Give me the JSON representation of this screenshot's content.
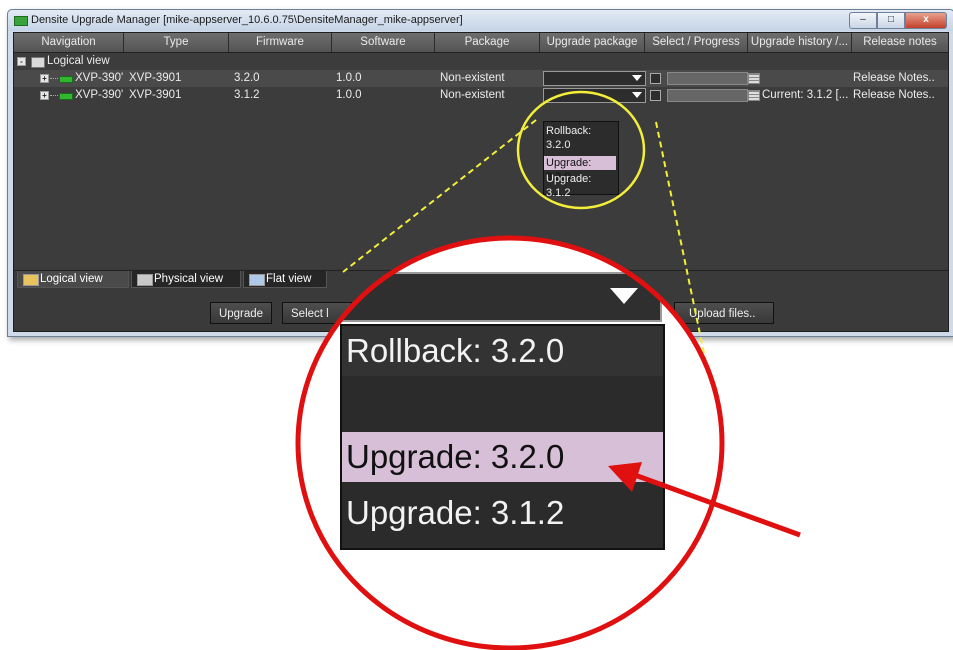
{
  "window": {
    "title": "Densite Upgrade Manager [mike-appserver_10.6.0.75\\DensiteManager_mike-appserver]",
    "min_glyph": "–",
    "max_glyph": "□",
    "close_glyph": "x"
  },
  "table": {
    "headers": [
      "Navigation",
      "Type",
      "Firmware",
      "Software",
      "Package",
      "Upgrade package",
      "Select / Progress",
      "Upgrade history /...",
      "Release notes"
    ],
    "root_label": "Logical view",
    "rows": [
      {
        "name": "XVP-390'",
        "type": "XVP-3901",
        "firmware": "3.2.0",
        "software": "1.0.0",
        "package": "Non-existent",
        "history": "",
        "notes": "Release Notes.."
      },
      {
        "name": "XVP-390'",
        "type": "XVP-3901",
        "firmware": "3.1.2",
        "software": "1.0.0",
        "package": "Non-existent",
        "history": "Current: 3.1.2 [...",
        "notes": "Release Notes.."
      }
    ]
  },
  "dropdown": {
    "items": [
      "Rollback: 3.2.0",
      "",
      "Upgrade: 3.2.0",
      "Upgrade: 3.1.2"
    ],
    "highlighted_index": 2,
    "highlight_color": "#d8bfd8"
  },
  "tabs": {
    "logical": "Logical view",
    "physical": "Physical view",
    "flat": "Flat view",
    "active": "logical"
  },
  "buttons": {
    "upgrade": "Upgrade",
    "select": "Select l",
    "upload": "Upload files.."
  },
  "callout": {
    "circle_color": "#e01010",
    "highlight_circle_color": "#f2ee3a",
    "arrow_color": "#e01010"
  }
}
